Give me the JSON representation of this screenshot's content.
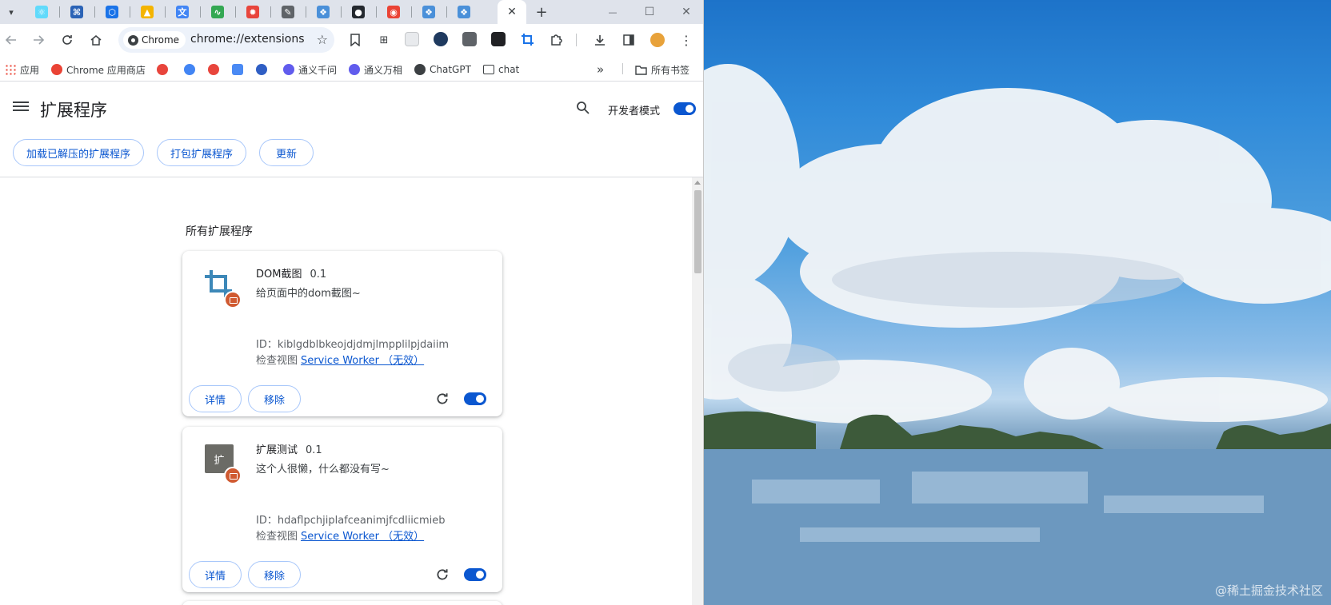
{
  "browser": {
    "tabs": [
      {
        "icon": "react-icon",
        "color": "#61dafb"
      },
      {
        "icon": "gitee-icon",
        "color": "#2b63b6"
      },
      {
        "icon": "hexagon-icon",
        "color": "#1a73e8"
      },
      {
        "icon": "drive-icon",
        "color": "#f4b400"
      },
      {
        "icon": "translate-icon",
        "color": "#4285f4"
      },
      {
        "icon": "wave-icon",
        "color": "#34a853"
      },
      {
        "icon": "bug-icon",
        "color": "#e8453c"
      },
      {
        "icon": "feather-icon",
        "color": "#5f6368"
      },
      {
        "icon": "codeium-icon",
        "color": "#4a90d9"
      },
      {
        "icon": "github-icon",
        "color": "#24292f"
      },
      {
        "icon": "chrome-icon",
        "color": "#ea4335"
      },
      {
        "icon": "codeium-icon",
        "color": "#4a90d9"
      },
      {
        "icon": "codeium-icon",
        "color": "#4a90d9"
      }
    ],
    "active_tab_close": "✕",
    "new_tab": "+",
    "window_controls": {
      "minimize": "—",
      "maximize": "☐",
      "close": "✕"
    },
    "toolbar": {
      "chip_label": "Chrome",
      "url": "chrome://extensions"
    },
    "bookmarks": [
      {
        "label": "应用",
        "icon": "apps-grid-icon",
        "color": "#ea4335"
      },
      {
        "label": "Chrome 应用商店",
        "icon": "webstore-icon",
        "color": "#ea4335"
      },
      {
        "label": "",
        "icon": "flame-icon",
        "color": "#e8453c"
      },
      {
        "label": "",
        "icon": "search-icon",
        "color": "#4285f4"
      },
      {
        "label": "",
        "icon": "bilibili-icon",
        "color": "#e8453c"
      },
      {
        "label": "",
        "icon": "note-icon",
        "color": "#4a8af4"
      },
      {
        "label": "",
        "icon": "paw-icon",
        "color": "#2f5ec4"
      },
      {
        "label": "通义千问",
        "icon": "tongyi-icon",
        "color": "#615ced"
      },
      {
        "label": "通义万相",
        "icon": "tongyi-icon",
        "color": "#615ced"
      },
      {
        "label": "ChatGPT",
        "icon": "chatgpt-icon",
        "color": "#3c4043"
      },
      {
        "label": "chat",
        "icon": "folder-icon",
        "color": "#3c4043"
      }
    ],
    "bookmarks_overflow": "»",
    "all_bookmarks": "所有书签"
  },
  "extensions_page": {
    "title": "扩展程序",
    "dev_mode_label": "开发者模式",
    "dev_mode_on": true,
    "actions": [
      "加载已解压的扩展程序",
      "打包扩展程序",
      "更新"
    ],
    "section_title": "所有扩展程序",
    "cards": [
      {
        "name": "DOM截图",
        "version": "0.1",
        "description": "给页面中的dom截图~",
        "id_label": "ID：kiblgdblbkeojdjdmjlmpplilpjdaiim",
        "inspect_label": "检查视图",
        "inspect_link": "Service Worker （无效）",
        "details_label": "详情",
        "remove_label": "移除",
        "enabled": true,
        "icon": "crop-icon"
      },
      {
        "name": "扩展测试",
        "version": "0.1",
        "description": "这个人很懒，什么都没有写~",
        "id_label": "ID：hdaflpchjiplafceanimjfcdliicmieb",
        "inspect_label": "检查视图",
        "inspect_link": "Service Worker （无效）",
        "details_label": "详情",
        "remove_label": "移除",
        "enabled": true,
        "icon_letter": "扩"
      }
    ]
  },
  "wallpaper": {
    "watermark": "@稀土掘金技术社区"
  }
}
